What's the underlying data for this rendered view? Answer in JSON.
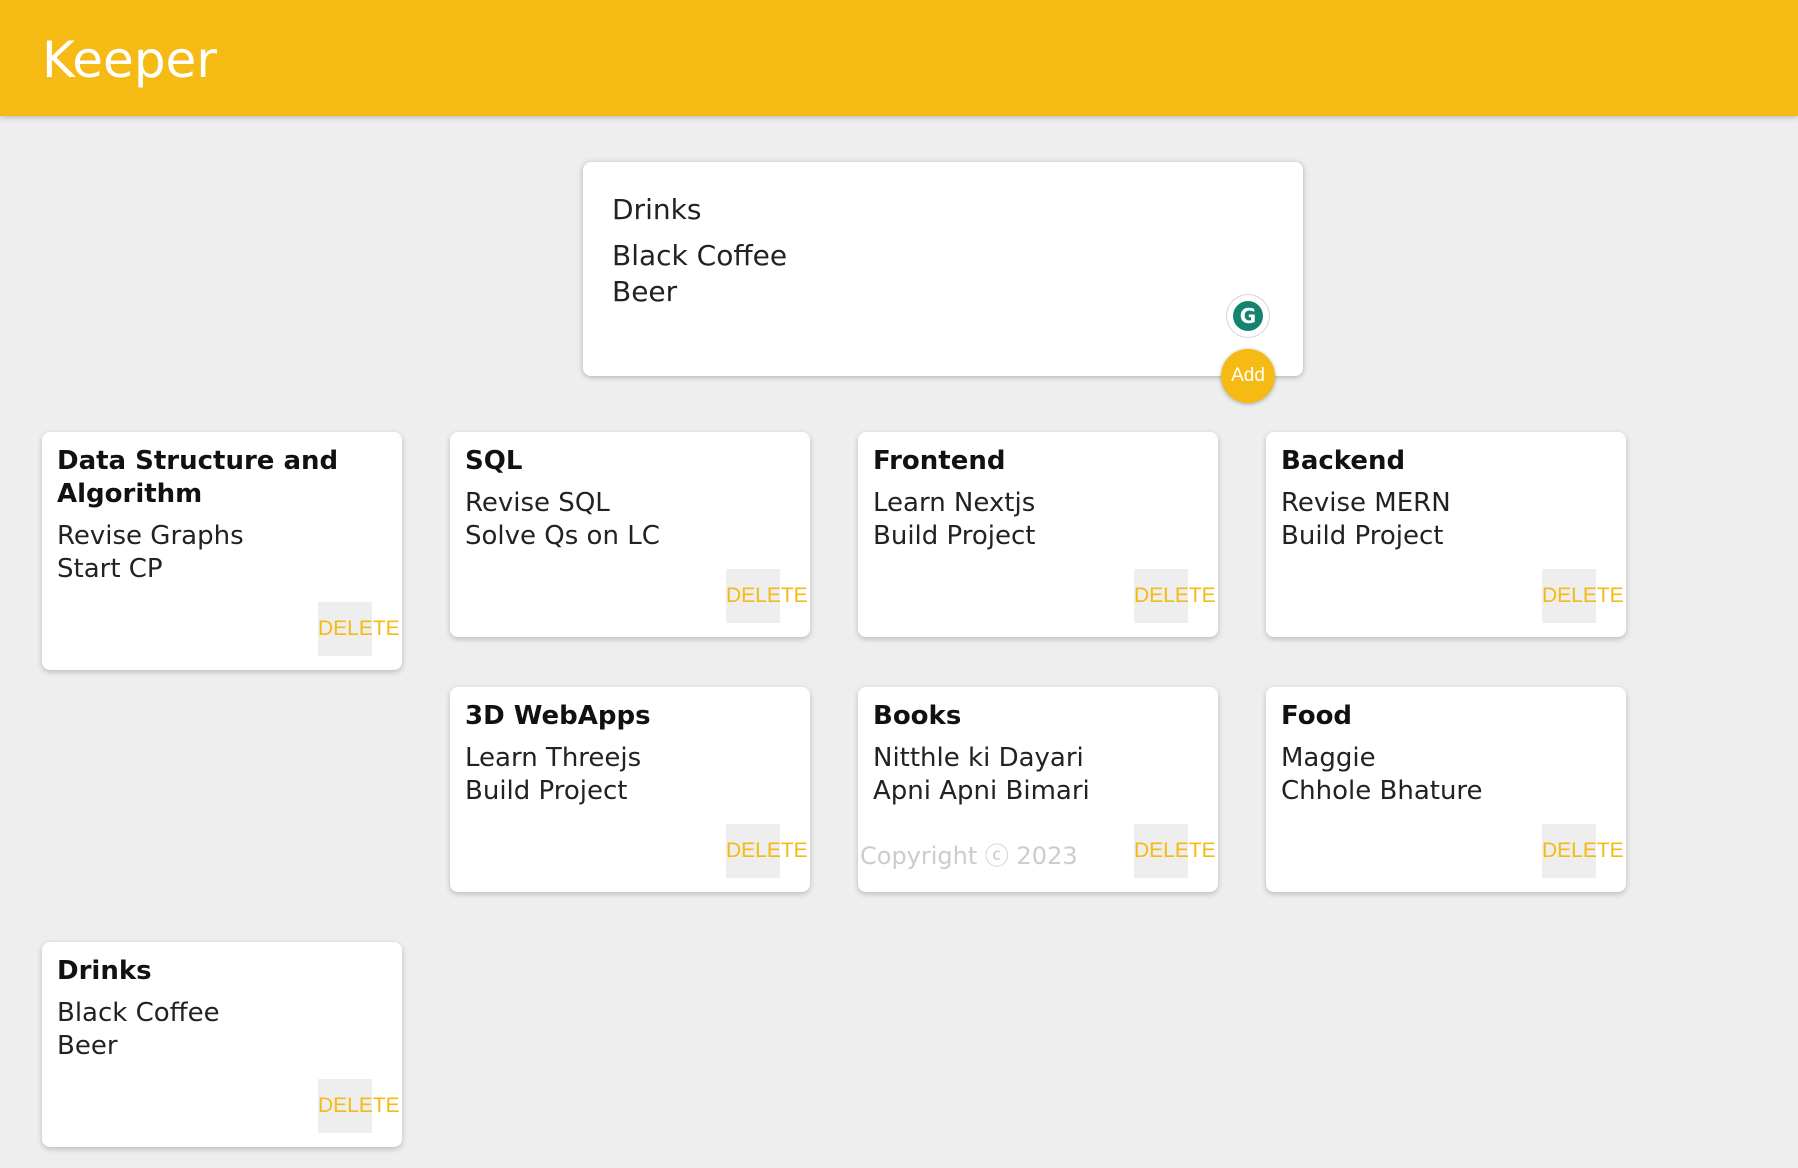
{
  "app": {
    "title": "Keeper"
  },
  "colors": {
    "accent": "#f5ba13",
    "background": "#eeeeee",
    "card": "#ffffff"
  },
  "compose": {
    "title_value": "Drinks",
    "content_value": "Black Coffee\nBeer",
    "add_label": "Add",
    "grammarly_icon": "grammarly-icon"
  },
  "notes": [
    {
      "title": "Data Structure and Algorithm",
      "content": "Revise Graphs\nStart CP",
      "delete_label": "DELETE"
    },
    {
      "title": "SQL",
      "content": "Revise SQL\nSolve Qs on LC",
      "delete_label": "DELETE"
    },
    {
      "title": "Frontend",
      "content": "Learn Nextjs\nBuild Project",
      "delete_label": "DELETE"
    },
    {
      "title": "Backend",
      "content": "Revise MERN\nBuild Project",
      "delete_label": "DELETE"
    },
    {
      "title": "3D WebApps",
      "content": "Learn Threejs\nBuild Project",
      "delete_label": "DELETE"
    },
    {
      "title": "Books",
      "content": "Nitthle ki Dayari\nApni Apni Bimari",
      "delete_label": "DELETE"
    },
    {
      "title": "Food",
      "content": "Maggie\nChhole Bhature",
      "delete_label": "DELETE"
    },
    {
      "title": "Drinks",
      "content": "Black Coffee\nBeer",
      "delete_label": "DELETE"
    }
  ],
  "footer": {
    "copyright": "Copyright ⓒ 2023"
  }
}
